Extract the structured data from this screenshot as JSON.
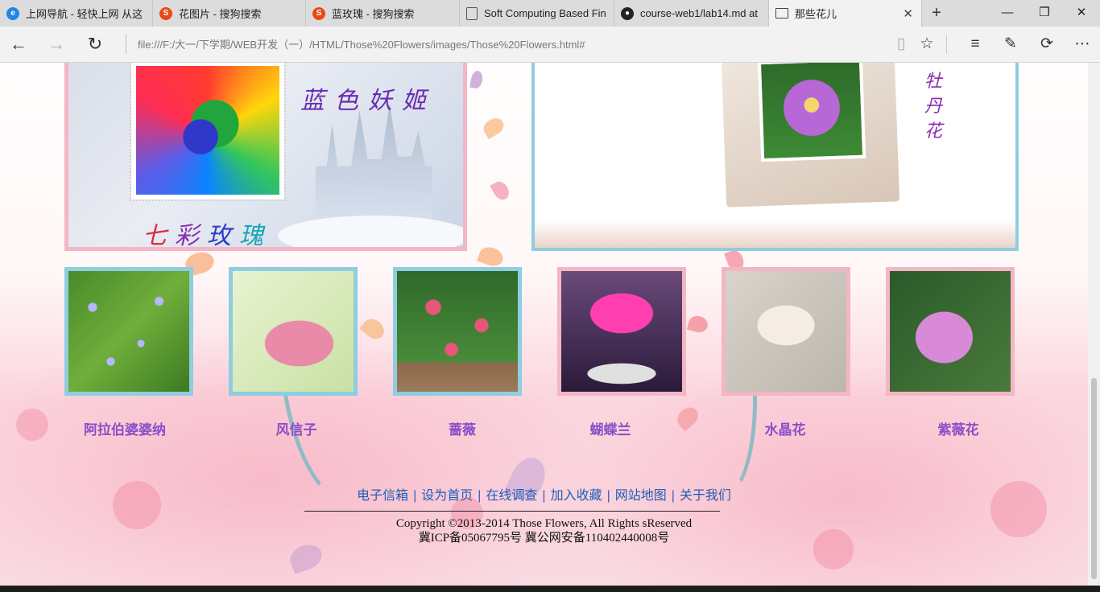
{
  "browser": {
    "tabs": [
      {
        "title": "上网导航 - 轻快上网 从这",
        "favicon": "ie-icon"
      },
      {
        "title": "花图片 - 搜狗搜索",
        "favicon": "sogou-icon"
      },
      {
        "title": "蓝玫瑰 - 搜狗搜索",
        "favicon": "sogou-icon"
      },
      {
        "title": "Soft Computing Based Fin",
        "favicon": "document-icon"
      },
      {
        "title": "course-web1/lab14.md at",
        "favicon": "github-icon"
      },
      {
        "title": "那些花儿",
        "favicon": "page-icon",
        "active": true
      }
    ],
    "address": "file:///F:/大一/下学期/WEB开发（一）/HTML/Those%20Flowers/images/Those%20Flowers.html#"
  },
  "page": {
    "banner_left": {
      "title": "蓝色妖姬",
      "caption": [
        "七",
        "彩",
        "玫",
        "瑰"
      ]
    },
    "banner_right": {
      "title": [
        "牡",
        "丹",
        "花"
      ]
    },
    "flowers": [
      {
        "label": "阿拉伯婆婆纳",
        "frame": "blue"
      },
      {
        "label": "风信子",
        "frame": "blue"
      },
      {
        "label": "蔷薇",
        "frame": "blue"
      },
      {
        "label": "蝴蝶兰",
        "frame": "pink"
      },
      {
        "label": "水晶花",
        "frame": "pink"
      },
      {
        "label": "紫薇花",
        "frame": "pink"
      }
    ],
    "footer": {
      "links": [
        "电子信箱",
        "设为首页",
        "在线调查",
        "加入收藏",
        "网站地图",
        "关于我们"
      ],
      "copyright": "Copyright ©2013-2014  Those  Flowers, All  Rights sReserved",
      "icp": "冀ICP备05067795号  冀公网安备110402440008号"
    }
  },
  "colors": {
    "frame_blue": "#8fcde0",
    "frame_pink": "#f2b6c4",
    "label_purple": "#8a4fc7",
    "link_blue": "#1f5db8"
  }
}
